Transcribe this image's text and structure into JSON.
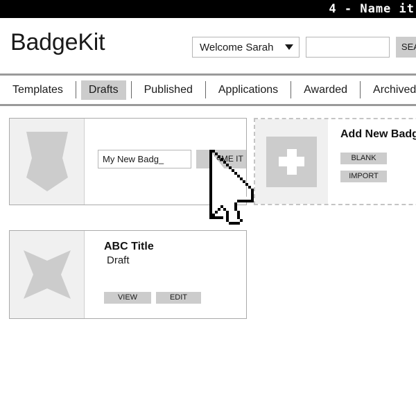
{
  "statusbar": {
    "title": "4 - Name it"
  },
  "header": {
    "brand": "BadgeKit",
    "user_menu": {
      "label": "Welcome Sarah",
      "icon": "chevron-down-icon"
    },
    "search": {
      "value": "",
      "placeholder": "",
      "button_label": "SEARCH"
    }
  },
  "nav": {
    "items": [
      {
        "label": "Templates",
        "active": false
      },
      {
        "label": "Drafts",
        "active": true
      },
      {
        "label": "Published",
        "active": false
      },
      {
        "label": "Applications",
        "active": false
      },
      {
        "label": "Awarded",
        "active": false
      },
      {
        "label": "Archived",
        "active": false
      }
    ]
  },
  "cards": {
    "new_badge": {
      "thumb_icon": "shield-badge-icon",
      "name_value": "My New Badg_",
      "name_placeholder": "",
      "confirm_label": "NAME IT"
    },
    "draft_badge": {
      "thumb_icon": "star-badge-icon",
      "title": "ABC Title",
      "status": "Draft",
      "view_label": "VIEW",
      "edit_label": "EDIT"
    },
    "add_new": {
      "thumb_icon": "plus-icon",
      "title": "Add New Badge",
      "blank_label": "BLANK",
      "import_label": "IMPORT"
    }
  },
  "cursor": {
    "icon": "mouse-pointer-cursor"
  },
  "colors": {
    "statusbar_bg": "#000000",
    "statusbar_text": "#ffffff",
    "button_gray": "#cccccc",
    "thumb_gray": "#f0f0f0",
    "badge_gray": "#cccccc",
    "border_gray": "#aaaaaa",
    "nav_rule": "#9a9a9a",
    "text": "#1a1a1a"
  }
}
